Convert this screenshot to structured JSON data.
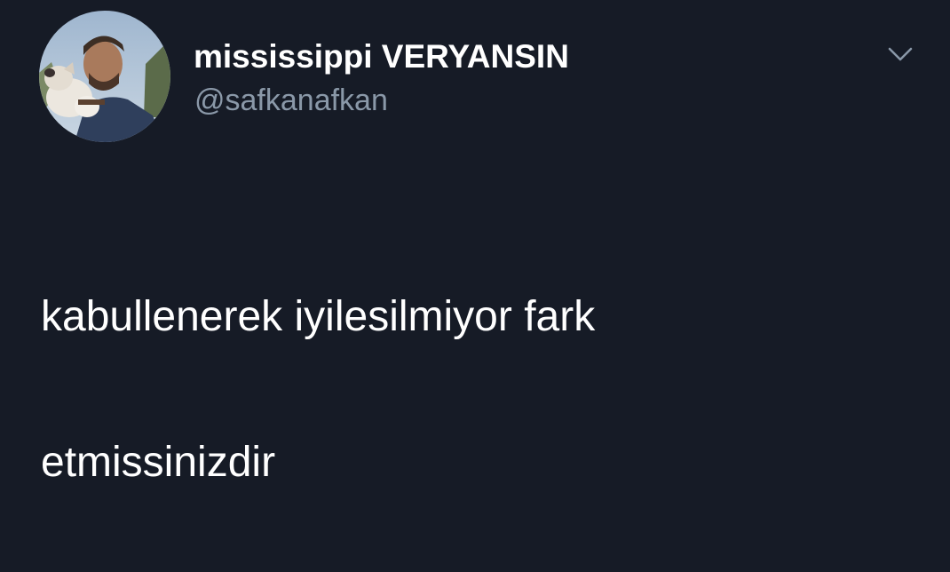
{
  "tweet": {
    "author": {
      "display_name": "mississippi VERYANSIN",
      "handle": "@safkanafkan",
      "avatar_icon": "profile-photo"
    },
    "more_icon": "chevron-down-icon",
    "text_lines": [
      "kabullenerek iyilesilmiyor fark",
      "etmissinizdir"
    ]
  },
  "colors": {
    "background": "#161b26",
    "primary_text": "#ffffff",
    "secondary_text": "#8a98a8"
  }
}
